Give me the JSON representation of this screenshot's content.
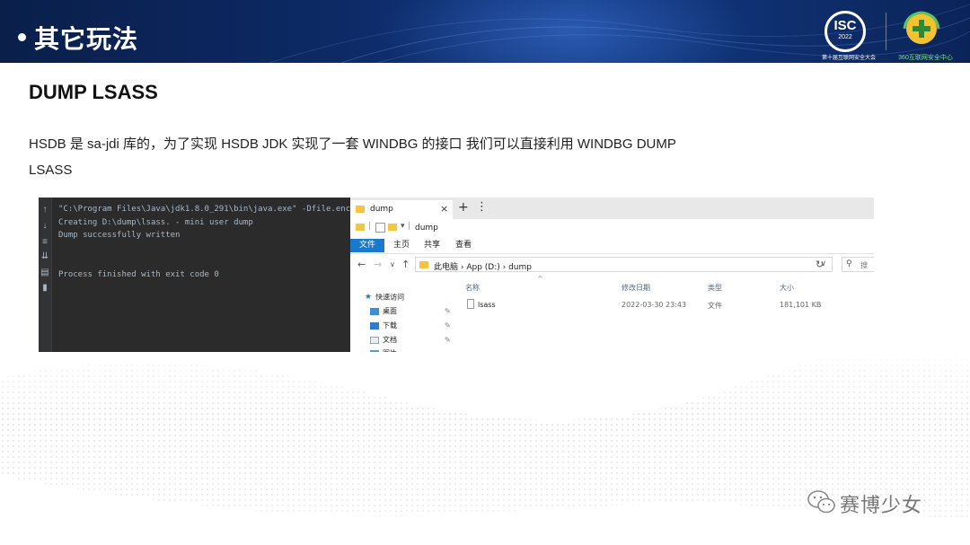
{
  "slide": {
    "title": "其它玩法",
    "heading": "DUMP LSASS",
    "description_line1": "HSDB 是 sa-jdi 库的，为了实现 HSDB JDK 实现了一套 WINDBG 的接口 我们可以直接利用 WINDBG DUMP",
    "description_line2": "LSASS"
  },
  "logos": {
    "isc_text": "ISC",
    "isc_year": "2022",
    "isc_caption": "第十届互联网安全大会",
    "c360_caption": "360互联网安全中心"
  },
  "ide_console": {
    "lines": [
      "\"C:\\Program Files\\Java\\jdk1.8.0_291\\bin\\java.exe\" -Dfile.enco",
      "Creating D:\\dump\\lsass. - mini user dump",
      "Dump successfully written",
      "",
      "",
      "Process finished with exit code 0"
    ]
  },
  "explorer": {
    "tab_label": "dump",
    "quick_access_label": "dump",
    "ribbon_tabs": [
      "文件",
      "主页",
      "共享",
      "查看"
    ],
    "breadcrumb": "此电脑  ›  App (D:)  ›  dump",
    "search_placeholder": "搜",
    "nav_items": [
      "快速访问",
      "桌面",
      "下载",
      "文档",
      "图片"
    ],
    "columns": [
      "名称",
      "修改日期",
      "类型",
      "大小"
    ],
    "files": [
      {
        "name": "lsass",
        "modified": "2022-03-30 23:43",
        "type": "文件",
        "size": "181,101 KB"
      }
    ]
  },
  "watermark": {
    "text": "赛博少女"
  }
}
